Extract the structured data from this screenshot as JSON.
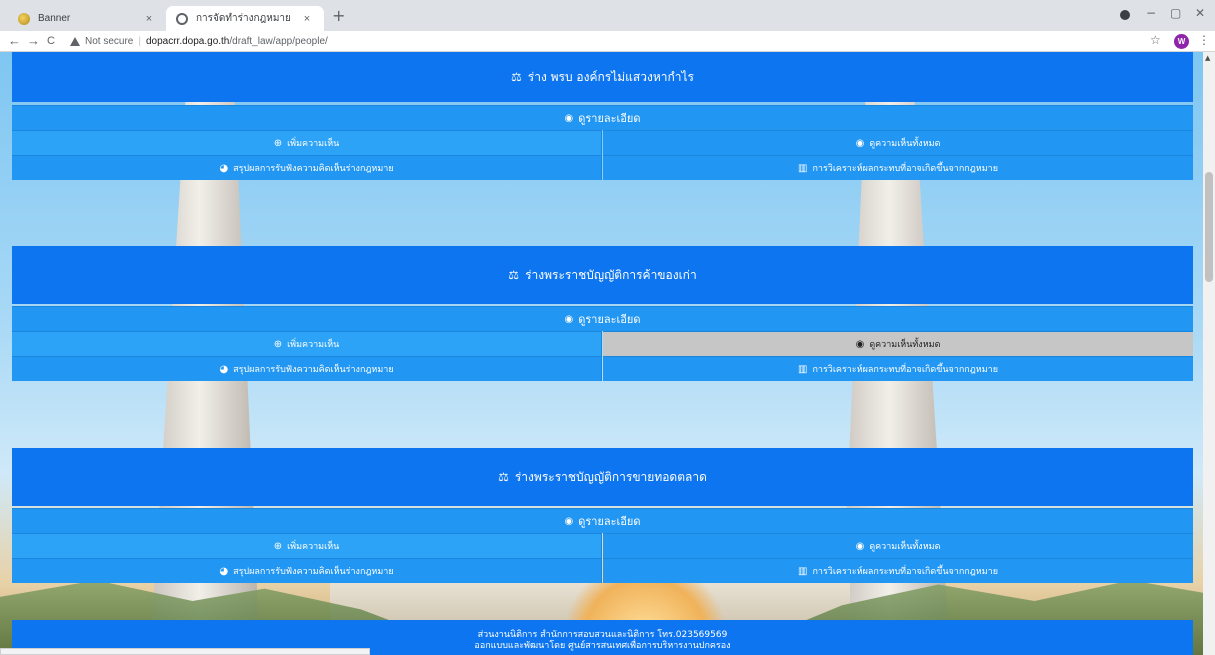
{
  "browser": {
    "tabs": [
      {
        "title": "Banner",
        "icon": "banner-favicon"
      },
      {
        "title": "การจัดทำร่างกฎหมาย",
        "icon": "globe-favicon"
      }
    ],
    "new_tab": "+",
    "close": "×",
    "security_label": "Not secure",
    "url_host": "dopacrr.dopa.go.th",
    "url_path": "/draft_law/app/people/",
    "profile_initial": "W",
    "back": "←",
    "forward": "→",
    "reload": "C",
    "star": "☆",
    "menu": "⋮",
    "minimize": "−",
    "restore": "▢",
    "close_window": "✕"
  },
  "icons": {
    "law": "⚖",
    "eye": "◉",
    "plus": "⊕",
    "pie": "◕",
    "chart": "▥"
  },
  "cards": [
    {
      "title": "ร่าง พรบ องค์กรไม่แสวงหากำไร",
      "details": "ดูรายละเอียด",
      "add_comment": "เพิ่มความเห็น",
      "view_all": "ดูความเห็นทั้งหมด",
      "summary": "สรุปผลการรับฟังความคิดเห็นร่างกฎหมาย",
      "impact": "การวิเคราะห์ผลกระทบที่อาจเกิดขึ้นจากกฎหมาย"
    },
    {
      "title": "ร่างพระราชบัญญัติการค้าของเก่า",
      "details": "ดูรายละเอียด",
      "add_comment": "เพิ่มความเห็น",
      "view_all": "ดูความเห็นทั้งหมด",
      "summary": "สรุปผลการรับฟังความคิดเห็นร่างกฎหมาย",
      "impact": "การวิเคราะห์ผลกระทบที่อาจเกิดขึ้นจากกฎหมาย"
    },
    {
      "title": "ร่างพระราชบัญญัติการขายทอดตลาด",
      "details": "ดูรายละเอียด",
      "add_comment": "เพิ่มความเห็น",
      "view_all": "ดูความเห็นทั้งหมด",
      "summary": "สรุปผลการรับฟังความคิดเห็นร่างกฎหมาย",
      "impact": "การวิเคราะห์ผลกระทบที่อาจเกิดขึ้นจากกฎหมาย"
    }
  ],
  "footer": {
    "line1": "ส่วนงานนิติการ สำนักการสอบสวนและนิติการ โทร.023569569",
    "line2": "ออกแบบและพัฒนาโดย ศูนย์สารสนเทศเพื่อการบริหารงานปกครอง"
  }
}
